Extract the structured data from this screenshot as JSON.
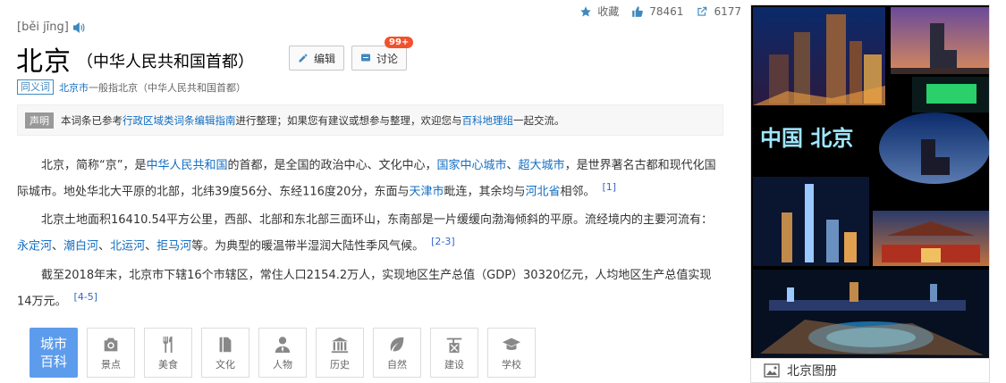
{
  "toolbar": {
    "collect_label": "收藏",
    "like_count": "78461",
    "share_count": "6177"
  },
  "header": {
    "pinyin": "[běi jīng]",
    "title": "北京",
    "subtitle": "（中华人民共和国首都）",
    "edit_label": "编辑",
    "discuss_label": "讨论",
    "discuss_badge": "99+"
  },
  "synonym": {
    "tag": "同义词",
    "link": "北京市",
    "text": "一般指北京（中华人民共和国首都）"
  },
  "notice": {
    "tag": "声明",
    "t1": "本词条已参考",
    "l1": "行政区域类词条编辑指南",
    "t2": "进行整理；如果您有建议或想参与整理，欢迎您与",
    "l2": "百科地理组",
    "t3": "一起交流。"
  },
  "paragraphs": {
    "p1": {
      "a": "北京，简称“京”，是",
      "l1": "中华人民共和国",
      "b": "的首都，是全国的政治中心、文化中心，",
      "l2": "国家中心城市",
      "c": "、",
      "l3": "超大城市",
      "d": "，是世界著名古都和现代化国际城市。地处华北大平原的北部，北纬39度56分、东经116度20分，东面与",
      "l4": "天津市",
      "e": "毗连，其余均与",
      "l5": "河北省",
      "f": "相邻。",
      "ref": "[1]"
    },
    "p2": {
      "a": "北京土地面积16410.54平方公里，西部、北部和东北部三面环山，东南部是一片缓缓向渤海倾斜的平原。流经境内的主要河流有：",
      "l1": "永定河",
      "b": "、",
      "l2": "潮白河",
      "c": "、",
      "l3": "北运河",
      "d": "、",
      "l4": "拒马河",
      "e": "等。为典型的暖温带半湿润大陆性季风气候。",
      "ref": "[2-3]"
    },
    "p3": {
      "a": "截至2018年末，北京市下辖16个市辖区，常住人口2154.2万人，实现地区生产总值（GDP）30320亿元，人均地区生产总值实现14万元。",
      "ref": "[4-5]"
    }
  },
  "city_bar": {
    "tag_line1": "城市",
    "tag_line2": "百科",
    "items": [
      {
        "label": "景点",
        "icon": "camera-icon"
      },
      {
        "label": "美食",
        "icon": "fork-knife-icon"
      },
      {
        "label": "文化",
        "icon": "book-icon"
      },
      {
        "label": "人物",
        "icon": "person-icon"
      },
      {
        "label": "历史",
        "icon": "temple-icon"
      },
      {
        "label": "自然",
        "icon": "leaf-icon"
      },
      {
        "label": "建设",
        "icon": "crane-icon"
      },
      {
        "label": "学校",
        "icon": "graduation-cap-icon"
      }
    ]
  },
  "sidebar": {
    "overlay_text": "中国 北京",
    "gallery_caption": "北京图册"
  },
  "colors": {
    "link": "#136ec2",
    "accent_blue": "#5d9cec",
    "badge_red": "#f2512c",
    "icon_blue": "#3f88bf"
  }
}
